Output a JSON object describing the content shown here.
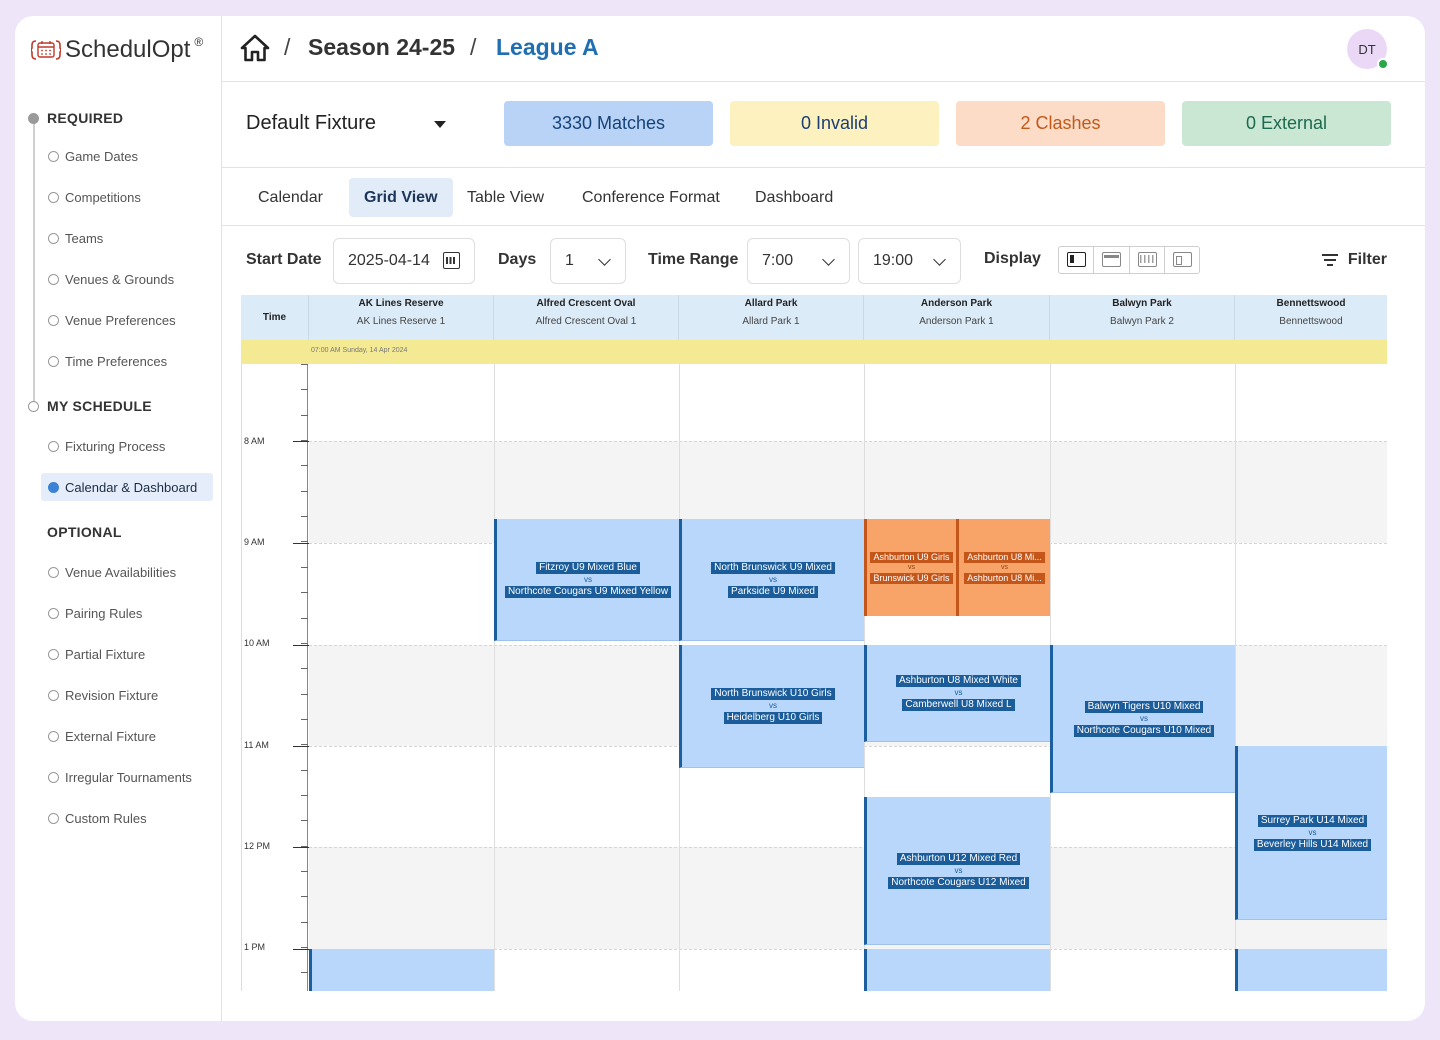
{
  "brand": {
    "name": "SchedulOpt",
    "reg": "®"
  },
  "sidebar": {
    "required_title": "REQUIRED",
    "required_items": [
      "Game Dates",
      "Competitions",
      "Teams",
      "Venues & Grounds",
      "Venue Preferences",
      "Time Preferences"
    ],
    "schedule_title": "MY SCHEDULE",
    "schedule_items": [
      "Fixturing Process",
      "Calendar & Dashboard"
    ],
    "optional_title": "OPTIONAL",
    "optional_items": [
      "Venue Availabilities",
      "Pairing Rules",
      "Partial Fixture",
      "Revision Fixture",
      "External Fixture",
      "Irregular Tournaments",
      "Custom Rules"
    ]
  },
  "breadcrumb": {
    "season": "Season 24-25",
    "separator": "/",
    "league": "League A"
  },
  "user": {
    "initials": "DT",
    "status": "online"
  },
  "fixture": {
    "selected": "Default Fixture",
    "stats": {
      "matches": "3330 Matches",
      "invalid": "0 Invalid",
      "clashes": "2 Clashes",
      "external": "0 External"
    }
  },
  "tabs": [
    "Calendar",
    "Grid View",
    "Table View",
    "Conference Format",
    "Dashboard"
  ],
  "active_tab": "Grid View",
  "controls": {
    "start_date_label": "Start Date",
    "start_date": "2025-04-14",
    "days_label": "Days",
    "days": "1",
    "time_range_label": "Time Range",
    "time_start": "7:00",
    "time_end": "19:00",
    "display_label": "Display",
    "filter_label": "Filter"
  },
  "grid": {
    "time_header": "Time",
    "day_banner": "07:00 AM Sunday, 14 Apr 2024",
    "venues": [
      {
        "venue": "AK Lines Reserve",
        "field": "AK Lines Reserve 1"
      },
      {
        "venue": "Alfred Crescent Oval",
        "field": "Alfred Crescent Oval 1"
      },
      {
        "venue": "Allard Park",
        "field": "Allard Park 1"
      },
      {
        "venue": "Anderson Park",
        "field": "Anderson Park 1"
      },
      {
        "venue": "Balwyn Park",
        "field": "Balwyn Park 2"
      },
      {
        "venue": "Bennettswood",
        "field": "Bennettswood"
      }
    ],
    "hours": [
      "8 AM",
      "9 AM",
      "10 AM",
      "11 AM",
      "12 PM",
      "1 PM"
    ],
    "vs_label": "vs",
    "matches": [
      {
        "home": "Fitzroy U9 Mixed Blue",
        "away": "Northcote Cougars U9 Mixed Yellow",
        "venue": "Alfred Crescent Oval"
      },
      {
        "home": "North Brunswick U9 Mixed",
        "away": "Parkside U9 Mixed",
        "venue": "Allard Park"
      },
      {
        "home": "Ashburton U9 Girls",
        "away": "Brunswick U9 Girls",
        "venue": "Anderson Park",
        "status": "clash"
      },
      {
        "home": "Ashburton U8 Mi...",
        "away": "Ashburton U8 Mi...",
        "venue": "Anderson Park",
        "status": "clash"
      },
      {
        "home": "North Brunswick U10 Girls",
        "away": "Heidelberg U10 Girls",
        "venue": "Allard Park"
      },
      {
        "home": "Ashburton U8 Mixed White",
        "away": "Camberwell U8 Mixed L",
        "venue": "Anderson Park"
      },
      {
        "home": "Balwyn Tigers U10 Mixed",
        "away": "Northcote Cougars U10 Mixed",
        "venue": "Balwyn Park"
      },
      {
        "home": "Surrey Park U14 Mixed",
        "away": "Beverley Hills U14 Mixed",
        "venue": "Bennettswood"
      },
      {
        "home": "Ashburton U12 Mixed Red",
        "away": "Northcote Cougars U12 Mixed",
        "venue": "Anderson Park"
      }
    ]
  },
  "colors": {
    "match_fill": "#b8d7fa",
    "match_accent": "#1b5c9b",
    "clash_fill": "#f8a468",
    "clash_accent": "#c4561a",
    "day_banner": "#f5ea94"
  }
}
